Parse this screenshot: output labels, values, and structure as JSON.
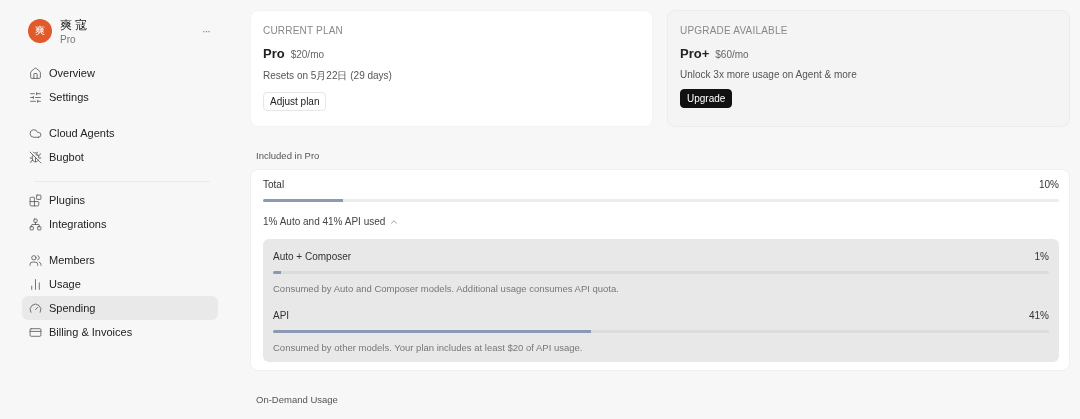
{
  "account": {
    "avatar": "爽",
    "name": "爽 寇",
    "plan": "Pro",
    "menu": "···"
  },
  "sidebar": {
    "groups": [
      {
        "items": [
          {
            "label": "Overview",
            "selected": false
          },
          {
            "label": "Settings",
            "selected": false
          }
        ]
      },
      {
        "items": [
          {
            "label": "Cloud Agents",
            "selected": false
          },
          {
            "label": "Bugbot",
            "selected": false
          }
        ]
      },
      {
        "items": [
          {
            "label": "Plugins",
            "selected": false
          },
          {
            "label": "Integrations",
            "selected": false
          }
        ]
      },
      {
        "items": [
          {
            "label": "Members",
            "selected": false
          },
          {
            "label": "Usage",
            "selected": false
          },
          {
            "label": "Spending",
            "selected": true
          },
          {
            "label": "Billing & Invoices",
            "selected": false
          }
        ]
      }
    ]
  },
  "plans": [
    {
      "kind": "current",
      "eyebrow": "CURRENT PLAN",
      "name": "Pro",
      "price": "$20/mo",
      "note": "Resets on 5月22日 (29 days)",
      "button": "Adjust plan"
    },
    {
      "kind": "upgrade",
      "eyebrow": "UPGRADE AVAILABLE",
      "name": "Pro+",
      "price": "$60/mo",
      "note": "Unlock 3x more usage on Agent & more",
      "button": "Upgrade"
    }
  ],
  "included": {
    "heading": "Included in Pro",
    "total": {
      "label": "Total",
      "reading": "10%",
      "level": 0.1
    },
    "breakdown": {
      "label": "1% Auto and 41% API used",
      "expanded": true
    },
    "items": [
      {
        "label": "Auto + Composer",
        "reading": "1%",
        "level": 0.01,
        "note": "Consumed by Auto and Composer models. Additional usage consumes API quota."
      },
      {
        "label": "API",
        "reading": "41%",
        "level": 0.41,
        "note": "Consumed by other models. Your plan includes at least $20 of API usage."
      }
    ]
  },
  "on_demand": {
    "heading": "On-Demand Usage"
  }
}
